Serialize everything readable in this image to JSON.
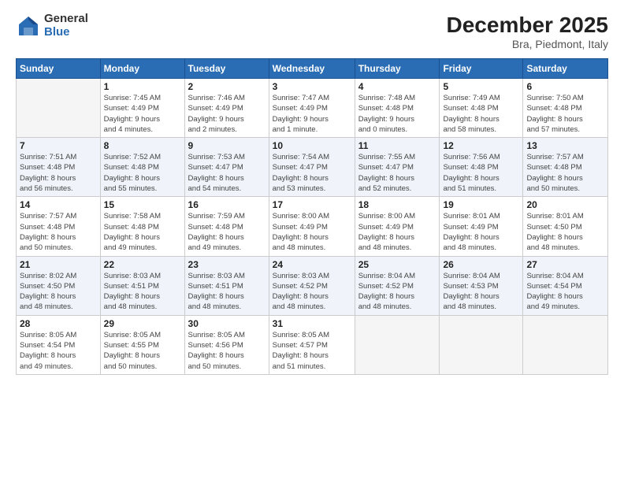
{
  "logo": {
    "general": "General",
    "blue": "Blue"
  },
  "title": "December 2025",
  "subtitle": "Bra, Piedmont, Italy",
  "headers": [
    "Sunday",
    "Monday",
    "Tuesday",
    "Wednesday",
    "Thursday",
    "Friday",
    "Saturday"
  ],
  "weeks": [
    [
      {
        "day": "",
        "info": ""
      },
      {
        "day": "1",
        "info": "Sunrise: 7:45 AM\nSunset: 4:49 PM\nDaylight: 9 hours\nand 4 minutes."
      },
      {
        "day": "2",
        "info": "Sunrise: 7:46 AM\nSunset: 4:49 PM\nDaylight: 9 hours\nand 2 minutes."
      },
      {
        "day": "3",
        "info": "Sunrise: 7:47 AM\nSunset: 4:49 PM\nDaylight: 9 hours\nand 1 minute."
      },
      {
        "day": "4",
        "info": "Sunrise: 7:48 AM\nSunset: 4:48 PM\nDaylight: 9 hours\nand 0 minutes."
      },
      {
        "day": "5",
        "info": "Sunrise: 7:49 AM\nSunset: 4:48 PM\nDaylight: 8 hours\nand 58 minutes."
      },
      {
        "day": "6",
        "info": "Sunrise: 7:50 AM\nSunset: 4:48 PM\nDaylight: 8 hours\nand 57 minutes."
      }
    ],
    [
      {
        "day": "7",
        "info": "Sunrise: 7:51 AM\nSunset: 4:48 PM\nDaylight: 8 hours\nand 56 minutes."
      },
      {
        "day": "8",
        "info": "Sunrise: 7:52 AM\nSunset: 4:48 PM\nDaylight: 8 hours\nand 55 minutes."
      },
      {
        "day": "9",
        "info": "Sunrise: 7:53 AM\nSunset: 4:47 PM\nDaylight: 8 hours\nand 54 minutes."
      },
      {
        "day": "10",
        "info": "Sunrise: 7:54 AM\nSunset: 4:47 PM\nDaylight: 8 hours\nand 53 minutes."
      },
      {
        "day": "11",
        "info": "Sunrise: 7:55 AM\nSunset: 4:47 PM\nDaylight: 8 hours\nand 52 minutes."
      },
      {
        "day": "12",
        "info": "Sunrise: 7:56 AM\nSunset: 4:48 PM\nDaylight: 8 hours\nand 51 minutes."
      },
      {
        "day": "13",
        "info": "Sunrise: 7:57 AM\nSunset: 4:48 PM\nDaylight: 8 hours\nand 50 minutes."
      }
    ],
    [
      {
        "day": "14",
        "info": "Sunrise: 7:57 AM\nSunset: 4:48 PM\nDaylight: 8 hours\nand 50 minutes."
      },
      {
        "day": "15",
        "info": "Sunrise: 7:58 AM\nSunset: 4:48 PM\nDaylight: 8 hours\nand 49 minutes."
      },
      {
        "day": "16",
        "info": "Sunrise: 7:59 AM\nSunset: 4:48 PM\nDaylight: 8 hours\nand 49 minutes."
      },
      {
        "day": "17",
        "info": "Sunrise: 8:00 AM\nSunset: 4:49 PM\nDaylight: 8 hours\nand 48 minutes."
      },
      {
        "day": "18",
        "info": "Sunrise: 8:00 AM\nSunset: 4:49 PM\nDaylight: 8 hours\nand 48 minutes."
      },
      {
        "day": "19",
        "info": "Sunrise: 8:01 AM\nSunset: 4:49 PM\nDaylight: 8 hours\nand 48 minutes."
      },
      {
        "day": "20",
        "info": "Sunrise: 8:01 AM\nSunset: 4:50 PM\nDaylight: 8 hours\nand 48 minutes."
      }
    ],
    [
      {
        "day": "21",
        "info": "Sunrise: 8:02 AM\nSunset: 4:50 PM\nDaylight: 8 hours\nand 48 minutes."
      },
      {
        "day": "22",
        "info": "Sunrise: 8:03 AM\nSunset: 4:51 PM\nDaylight: 8 hours\nand 48 minutes."
      },
      {
        "day": "23",
        "info": "Sunrise: 8:03 AM\nSunset: 4:51 PM\nDaylight: 8 hours\nand 48 minutes."
      },
      {
        "day": "24",
        "info": "Sunrise: 8:03 AM\nSunset: 4:52 PM\nDaylight: 8 hours\nand 48 minutes."
      },
      {
        "day": "25",
        "info": "Sunrise: 8:04 AM\nSunset: 4:52 PM\nDaylight: 8 hours\nand 48 minutes."
      },
      {
        "day": "26",
        "info": "Sunrise: 8:04 AM\nSunset: 4:53 PM\nDaylight: 8 hours\nand 48 minutes."
      },
      {
        "day": "27",
        "info": "Sunrise: 8:04 AM\nSunset: 4:54 PM\nDaylight: 8 hours\nand 49 minutes."
      }
    ],
    [
      {
        "day": "28",
        "info": "Sunrise: 8:05 AM\nSunset: 4:54 PM\nDaylight: 8 hours\nand 49 minutes."
      },
      {
        "day": "29",
        "info": "Sunrise: 8:05 AM\nSunset: 4:55 PM\nDaylight: 8 hours\nand 50 minutes."
      },
      {
        "day": "30",
        "info": "Sunrise: 8:05 AM\nSunset: 4:56 PM\nDaylight: 8 hours\nand 50 minutes."
      },
      {
        "day": "31",
        "info": "Sunrise: 8:05 AM\nSunset: 4:57 PM\nDaylight: 8 hours\nand 51 minutes."
      },
      {
        "day": "",
        "info": ""
      },
      {
        "day": "",
        "info": ""
      },
      {
        "day": "",
        "info": ""
      }
    ]
  ]
}
